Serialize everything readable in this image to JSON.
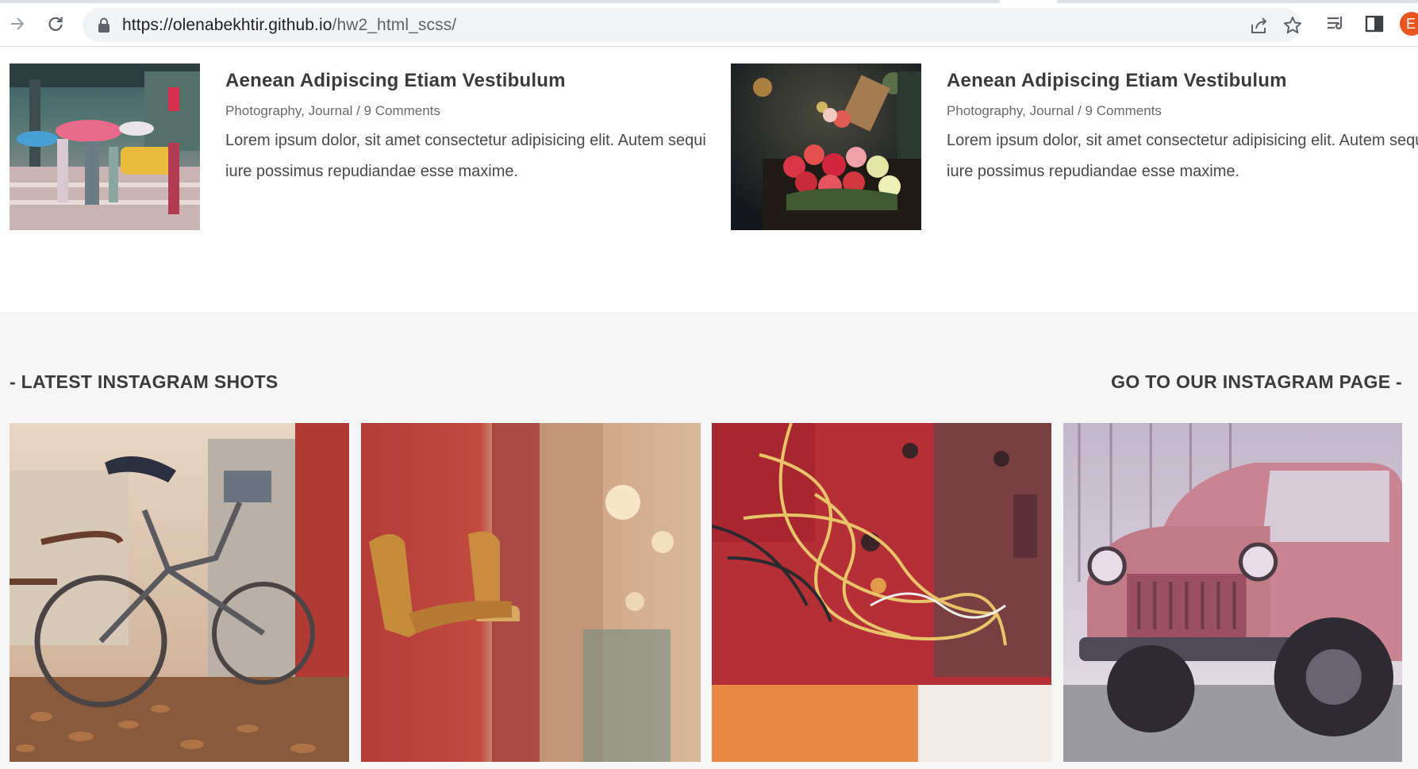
{
  "browser": {
    "url_host": "https://olenabekhtir.github.io",
    "url_path": "/hw2_html_scss/",
    "profile_initial": "E",
    "icons": [
      "forward-icon",
      "reload-icon",
      "lock-icon",
      "share-icon",
      "star-icon",
      "reading-list-icon",
      "side-panel-icon",
      "profile-avatar"
    ]
  },
  "posts": [
    {
      "title": "Aenean Adipiscing Etiam Vestibulum",
      "categories": "Photography, Journal",
      "separator": " / ",
      "comments": "9 Comments",
      "text": "Lorem ipsum dolor, sit amet consectetur adipisicing elit. Autem sequi iure possimus repudiandae esse maxime.",
      "image": "rainy-street-umbrellas-photo"
    },
    {
      "title": "Aenean Adipiscing Etiam Vestibulum",
      "categories": "Photography, Journal",
      "separator": " / ",
      "comments": "9 Comments",
      "text": "Lorem ipsum dolor, sit amet consectetur adipisicing elit. Autem sequi iure possimus repudiandae esse maxime.",
      "image": "roses-cart-street-photo"
    }
  ],
  "instagram": {
    "left_heading": "- LATEST INSTAGRAM SHOTS",
    "right_link": "GO TO OUR INSTAGRAM PAGE -",
    "shots": [
      "vintage-bicycle-photo",
      "door-handle-hallway-photo",
      "rusty-wires-photo",
      "old-pink-truck-photo"
    ]
  },
  "colors": {
    "heading": "#3b3b3b",
    "meta": "#6a6a6a",
    "section_bg": "#f6f6f6",
    "profile": "#e8561e"
  }
}
